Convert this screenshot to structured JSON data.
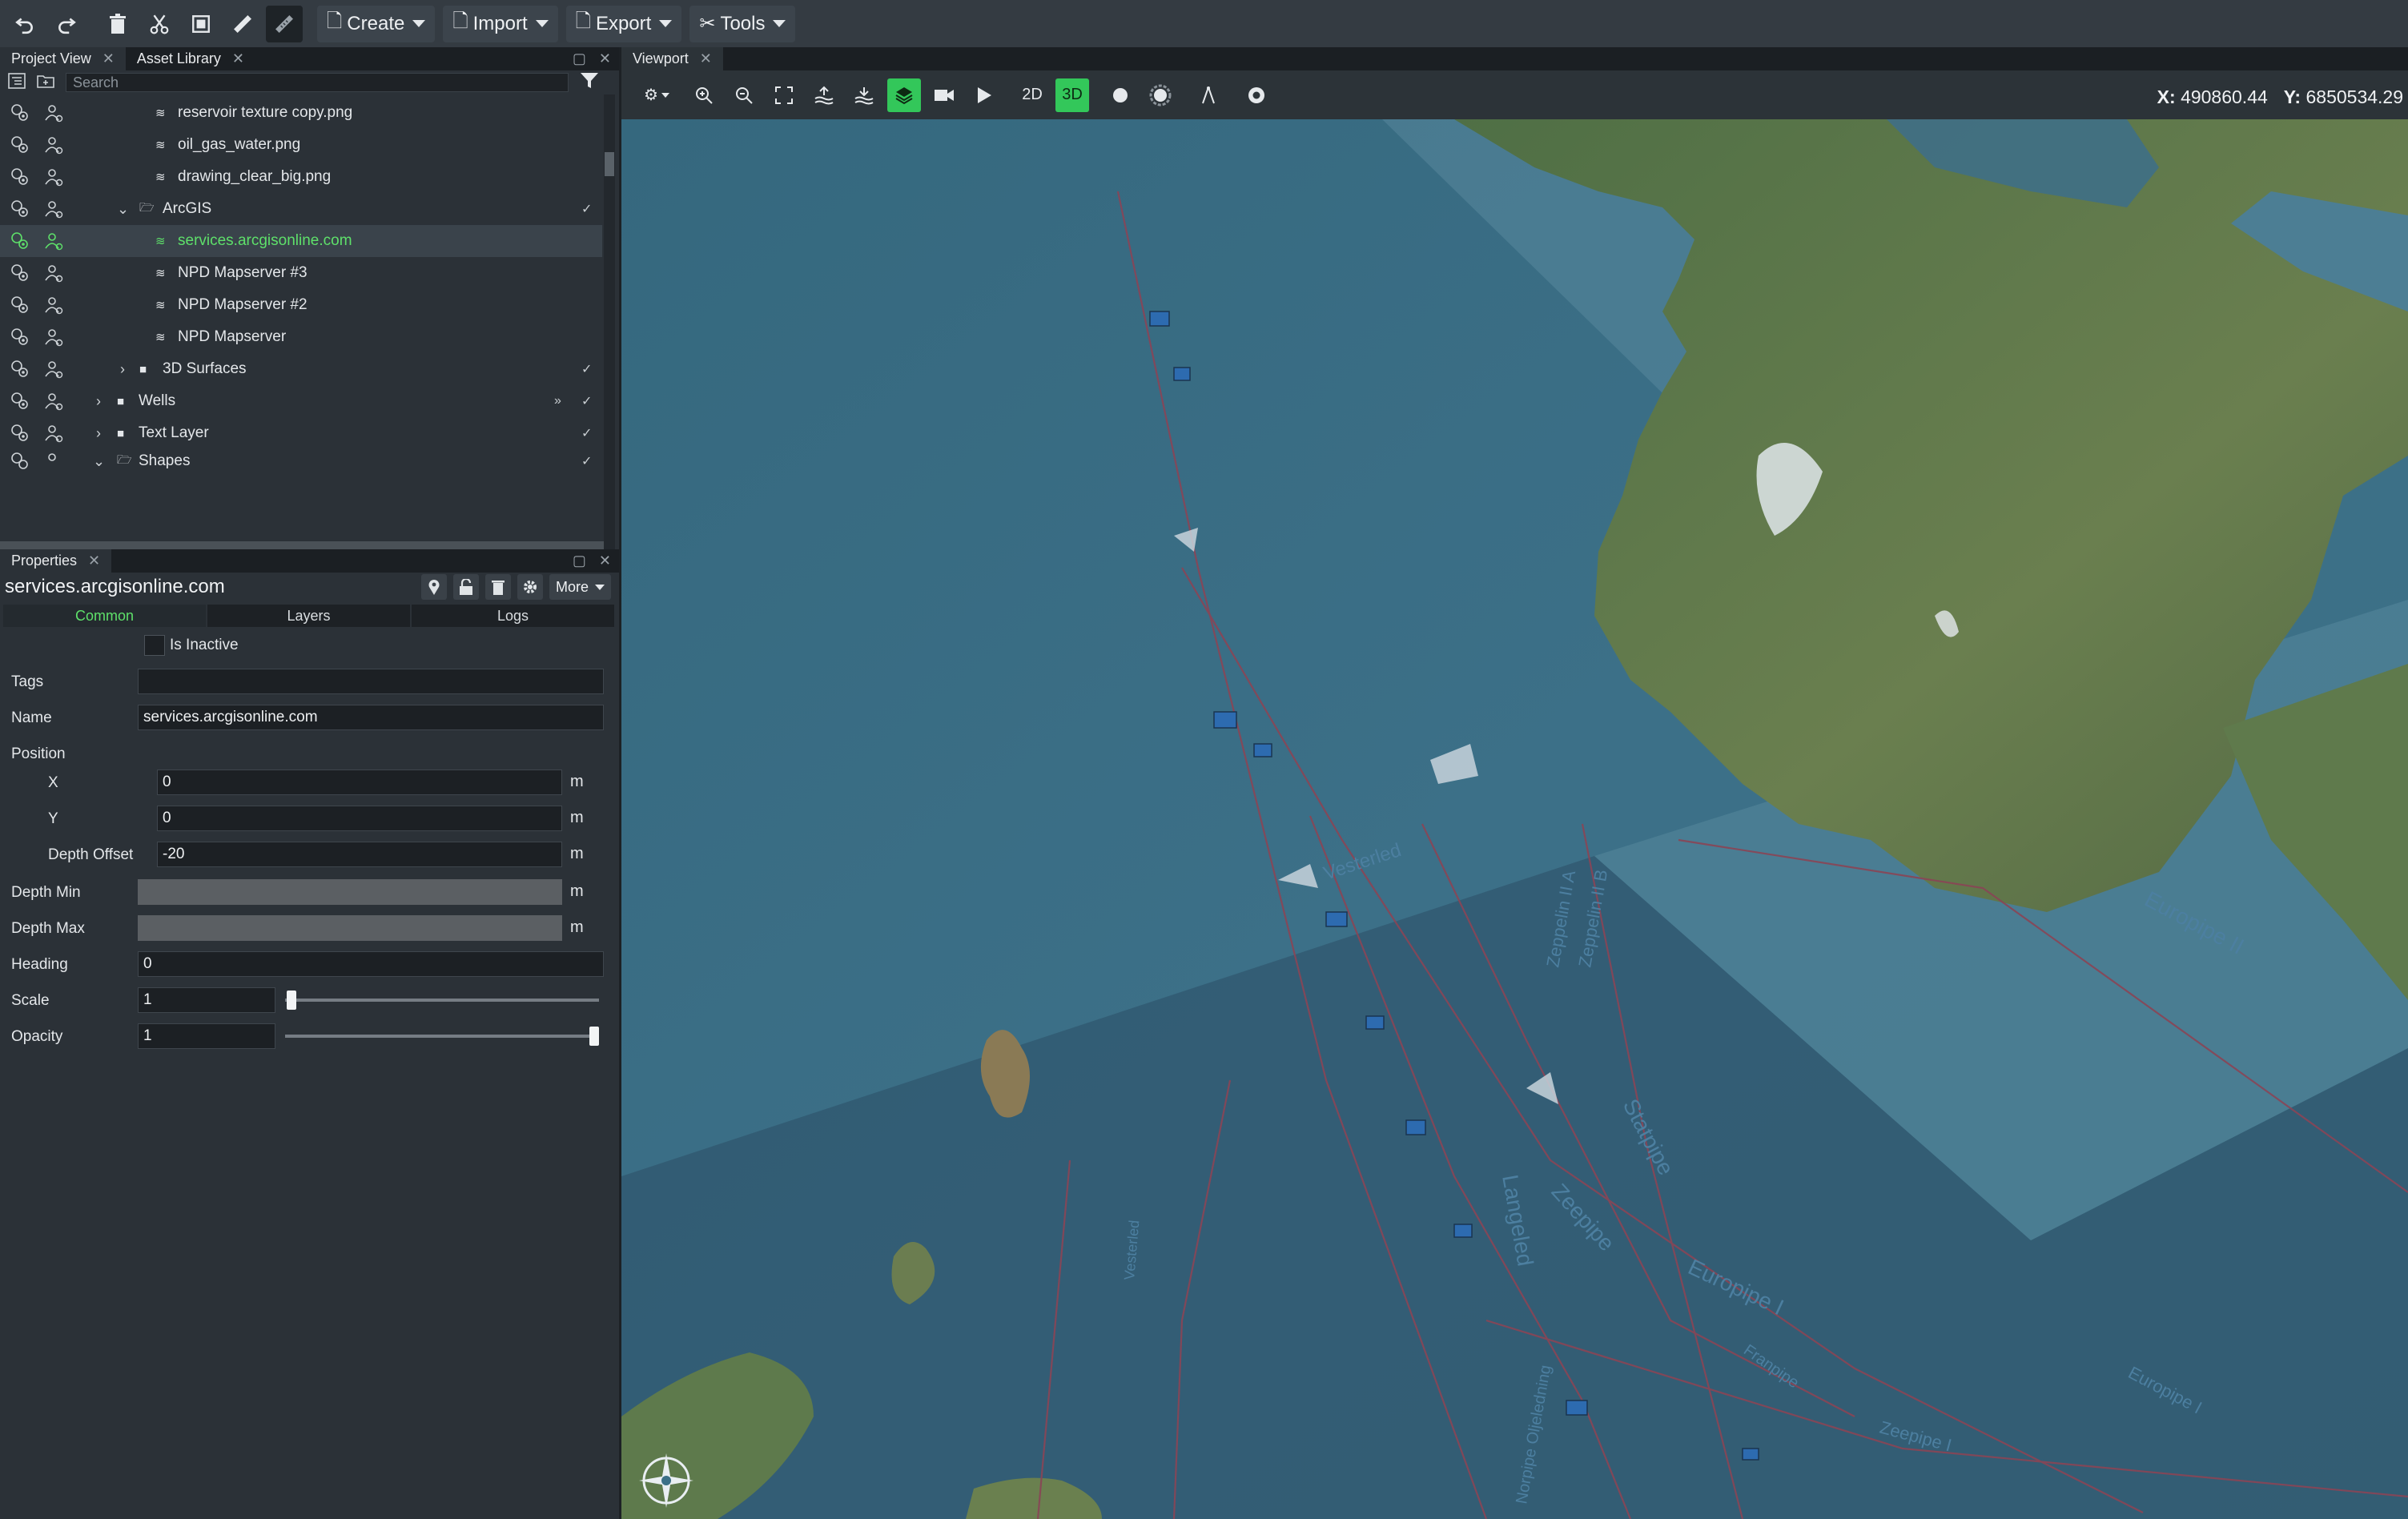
{
  "toolbar": {
    "menus": {
      "create": "Create",
      "import": "Import",
      "export": "Export",
      "tools": "Tools"
    },
    "icons": [
      "undo-icon",
      "redo-icon",
      "delete-icon",
      "cut-icon",
      "frame-icon",
      "ruler-icon",
      "measure-icon"
    ]
  },
  "project_panel": {
    "tabs": {
      "project_view": "Project View",
      "asset_library": "Asset Library"
    },
    "search_placeholder": "Search",
    "tree": [
      {
        "label": "reservoir texture copy.png"
      },
      {
        "label": "oil_gas_water.png"
      },
      {
        "label": "drawing_clear_big.png"
      },
      {
        "label": "ArcGIS"
      },
      {
        "label": "services.arcgisonline.com",
        "selected": true
      },
      {
        "label": "NPD Mapserver #3"
      },
      {
        "label": "NPD Mapserver #2"
      },
      {
        "label": "NPD Mapserver"
      },
      {
        "label": "3D Surfaces"
      },
      {
        "label": "Wells"
      },
      {
        "label": "Text Layer"
      },
      {
        "label": "Shapes"
      }
    ]
  },
  "properties": {
    "tab": "Properties",
    "title": "services.arcgisonline.com",
    "more_label": "More",
    "subtabs": {
      "common": "Common",
      "layers": "Layers",
      "logs": "Logs"
    },
    "is_inactive_label": "Is Inactive",
    "tags_label": "Tags",
    "tags_value": "",
    "name_label": "Name",
    "name_value": "services.arcgisonline.com",
    "position_label": "Position",
    "x_label": "X",
    "x_value": "0",
    "y_label": "Y",
    "y_value": "0",
    "depth_offset_label": "Depth Offset",
    "depth_offset_value": "-20",
    "depth_min_label": "Depth Min",
    "depth_max_label": "Depth Max",
    "heading_label": "Heading",
    "heading_value": "0",
    "scale_label": "Scale",
    "scale_value": "1",
    "opacity_label": "Opacity",
    "opacity_value": "1",
    "unit": "m"
  },
  "viewport": {
    "tab": "Viewport",
    "mode_2d": "2D",
    "mode_3d": "3D",
    "active_mode": "3D",
    "x_label": "X:",
    "x_value": "490860.44",
    "y_label": "Y:",
    "y_value": "6850534.29"
  },
  "map_labels": {
    "europipe_ii": "Europipe II",
    "europipe_i": "Europipe I",
    "europipe_i_2": "Europipe I",
    "statpipe": "Statpipe",
    "zeepipe": "Zeepipe",
    "zeepipe_i": "Zeepipe I",
    "zeepipe_ii_a": "Zeppelin II A",
    "zeepipe_ii_b": "Zeppelin II B",
    "vesterled": "Vesterled",
    "langeled": "Langeled",
    "franpipe": "Franpipe",
    "norpipe": "Norpipe Oljeledning",
    "vestled": "Vesterled"
  },
  "colors": {
    "accent": "#33c75a",
    "sea": "#3b6f86",
    "land": "#5d7a48",
    "pipeline": "#8a4a5a"
  }
}
